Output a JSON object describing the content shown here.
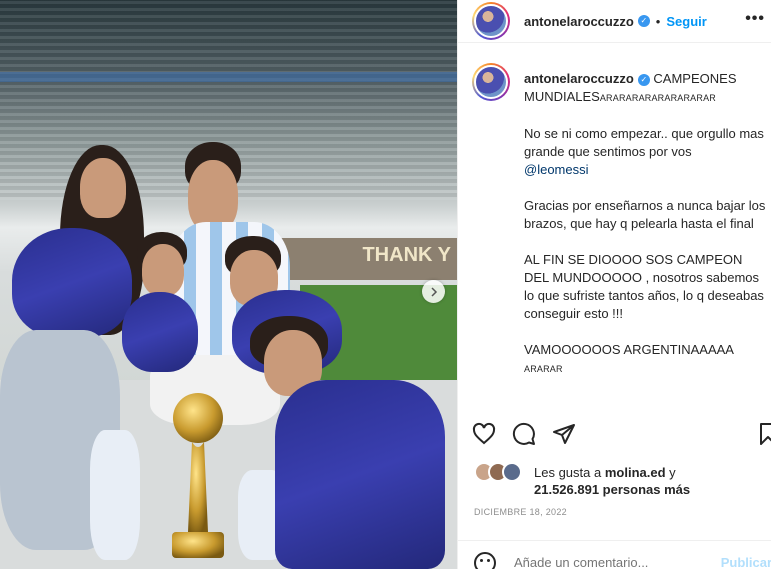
{
  "post": {
    "username": "antonelaroccuzzo",
    "follow_label": "Seguir",
    "more_label": "•••",
    "verified_icon": "verified-badge-icon",
    "accent_color": "#0095f6"
  },
  "photo": {
    "banner_text": "THANK Y"
  },
  "caption": {
    "username": "antonelaroccuzzo",
    "line1": "CAMPEONES MUNDIALES",
    "line1_tail": "ARARARARARARARARAR",
    "para1": "No se ni como empezar.. que orgullo mas grande que sentimos por vos",
    "mention": "@leomessi",
    "para2": "Gracias por enseñarnos a nunca bajar los brazos, que hay q pelearla hasta el final",
    "para3": "AL FIN SE DIOOOO SOS CAMPEON DEL MUNDOOOOO , nosotros sabemos lo que sufriste tantos años, lo q deseabas conseguir esto !!!",
    "para4": "VAMOOOOOOS ARGENTINAAAAA",
    "para4_tail": "ARARAR"
  },
  "actions": {
    "like_icon": "heart-icon",
    "comment_icon": "comment-icon",
    "share_icon": "share-icon",
    "save_icon": "bookmark-icon"
  },
  "likes": {
    "prefix": "Les gusta a",
    "user": "molina.ed",
    "conj": "y",
    "count": "21.526.891 personas más"
  },
  "date": "DICIEMBRE 18, 2022",
  "comment": {
    "placeholder": "Añade un comentario...",
    "publish_label": "Publicar",
    "emoji_icon": "emoji-icon"
  }
}
